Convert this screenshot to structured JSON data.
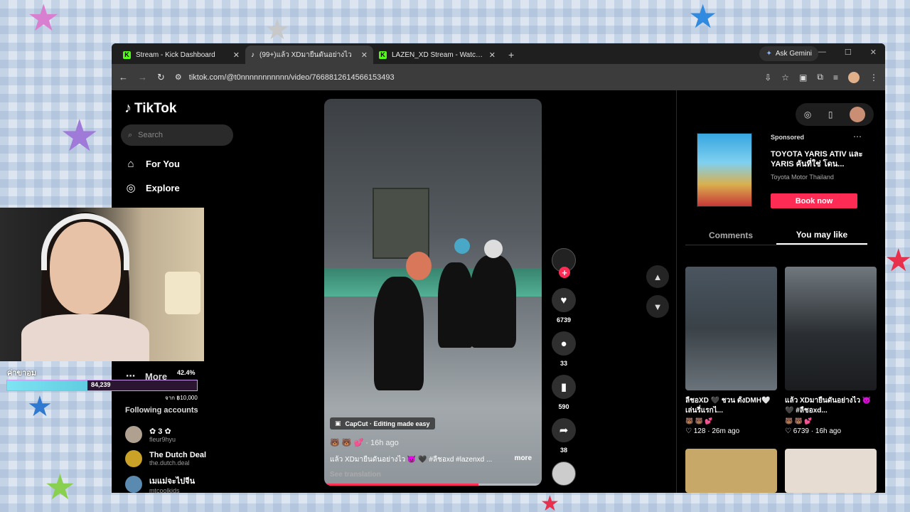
{
  "browser": {
    "tabs": [
      {
        "title": "Stream - Kick Dashboard",
        "icon": "kick-icon",
        "active": false
      },
      {
        "title": "(99+)แล้ว XDมายืนดันอย่างไว",
        "icon": "tiktok-icon",
        "active": true
      },
      {
        "title": "LAZEN_XD Stream - Watch Live",
        "icon": "kick-icon",
        "active": false
      }
    ],
    "new_tab": "+",
    "gemini_label": "Ask Gemini",
    "url": "tiktok.com/@t0nnnnnnnnnnn/video/7668812614566153493"
  },
  "tiktok": {
    "logo": "TikTok",
    "search_placeholder": "Search",
    "nav": [
      {
        "label": "For You",
        "icon": "home-icon"
      },
      {
        "label": "Explore",
        "icon": "compass-icon"
      }
    ],
    "more_label": "More",
    "following_header": "Following accounts",
    "following": [
      {
        "name": "✿ 3 ✿",
        "handle": "fleur9hyu",
        "color": "#b0a090"
      },
      {
        "name": "The Dutch Deal",
        "handle": "the.dutch.deal",
        "color": "#c9a227"
      },
      {
        "name": "เมแม่จะไปจีน",
        "handle": "mtcoolkids",
        "color": "#5a8ab0"
      }
    ]
  },
  "video": {
    "capcut": "CapCut · Editing made easy",
    "meta_emoji": "🐻 🐻 💕",
    "meta_time": "· 16h ago",
    "description": "แล้ว XDมายืนดันอย่างไว 👿 🖤 #ลืชอxd #lazenxd ...",
    "more_label": "more",
    "see_translation": "See translation",
    "progress": 0.71
  },
  "actions": {
    "likes": "6739",
    "comments": "33",
    "saves": "590",
    "shares": "38"
  },
  "ad": {
    "sponsored": "Sponsored",
    "title": "TOYOTA YARIS ATIV และ YARIS คันที่ใช่ โดน...",
    "brand": "Toyota Motor Thailand",
    "cta": "Book now"
  },
  "right_tabs": [
    {
      "label": "Comments",
      "active": false
    },
    {
      "label": "You may like",
      "active": true
    }
  ],
  "recommendations": [
    {
      "title": "ลืชอXD 🖤 ชวน ตั้งDMH🤍 เล่นรี่แรกไ...",
      "emoji": "🐻 🐻 💕",
      "likes": "♡ 128",
      "time": "· 26m ago"
    },
    {
      "title": "แล้ว XDมายืนดันอย่างไว 👿 🖤 #ลืชอxd...",
      "emoji": "🐻 🐻 💕",
      "likes": "♡ 6739",
      "time": "· 16h ago"
    }
  ],
  "stream_overlay": {
    "goal_label": "ค่าขาอม",
    "goal_value": "84,239",
    "goal_percent": "42.4%",
    "goal_target": "จาก ฿10,000",
    "goal_fraction": 0.424
  }
}
